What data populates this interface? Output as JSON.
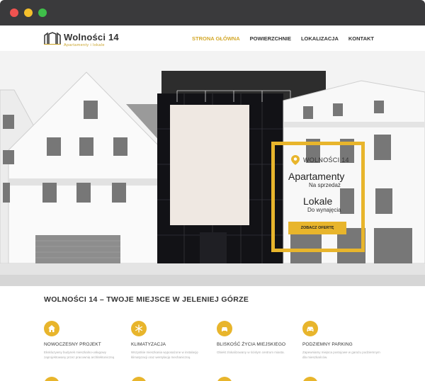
{
  "browser": {
    "window_controls": [
      "close",
      "minimize",
      "maximize"
    ]
  },
  "header": {
    "logo_title": "Wolności 14",
    "logo_subtitle": "Apartamenty i lokale",
    "nav": [
      {
        "label": "STRONA GŁÓWNA",
        "active": true
      },
      {
        "label": "POWIERZCHNIE",
        "active": false
      },
      {
        "label": "LOKALIZACJA",
        "active": false
      },
      {
        "label": "KONTAKT",
        "active": false
      }
    ]
  },
  "hero": {
    "address": "WOLNOŚCI 14",
    "offer1_title": "Apartamenty",
    "offer1_sub": "Na sprzedaż",
    "offer2_title": "Lokale",
    "offer2_sub": "Do wynajęcia",
    "cta_label": "ZOBACZ OFERTĘ"
  },
  "main": {
    "section_title": "WOLNOŚCI 14 – TWOJE MIEJSCE W JELENIEJ GÓRZE",
    "features": [
      {
        "icon": "home-icon",
        "title": "NOWOCZESNY PROJEKT",
        "desc": "Ekskluzywny budynek mieszkalno-usługowy zaprojektowany przez pracownię architektoniczną"
      },
      {
        "icon": "snowflake-icon",
        "title": "KLIMATYZACJA",
        "desc": "Wszystkie mieszkania wyposażone w instalację klimatyzacji oraz wentylację mechaniczną."
      },
      {
        "icon": "car-icon",
        "title": "BLISKOŚĆ ŻYCIA MIEJSKIEGO",
        "desc": "Obiekt zlokalizowany w ścisłym centrum miasta."
      },
      {
        "icon": "parking-icon",
        "title": "PODZIEMNY PARKING",
        "desc": "Zapewniamy miejsca postojowe w garażu podziemnym dla mieszkańców."
      }
    ]
  },
  "colors": {
    "accent": "#e8b52c",
    "chrome": "#3a3a3c",
    "text": "#333333"
  }
}
